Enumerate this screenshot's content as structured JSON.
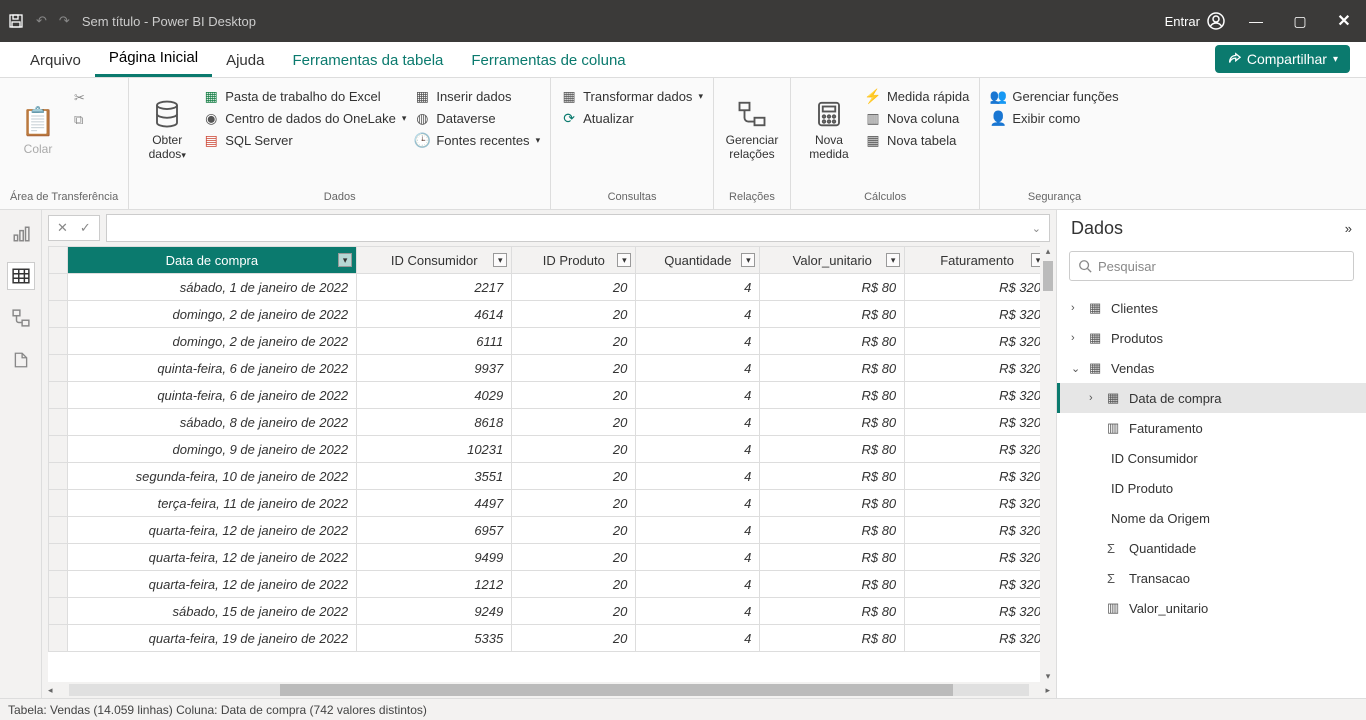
{
  "titlebar": {
    "title": "Sem título - Power BI Desktop",
    "sign_in": "Entrar"
  },
  "tabs": {
    "file": "Arquivo",
    "home": "Página Inicial",
    "help": "Ajuda",
    "table_tools": "Ferramentas da tabela",
    "column_tools": "Ferramentas de coluna",
    "share": "Compartilhar"
  },
  "ribbon": {
    "clipboard": {
      "paste": "Colar",
      "label": "Área de Transferência"
    },
    "data": {
      "get_data": "Obter dados",
      "excel": "Pasta de trabalho do Excel",
      "onelake": "Centro de dados do OneLake",
      "sql": "SQL Server",
      "enter_data": "Inserir dados",
      "dataverse": "Dataverse",
      "recent": "Fontes recentes",
      "label": "Dados"
    },
    "queries": {
      "transform": "Transformar dados",
      "refresh": "Atualizar",
      "label": "Consultas"
    },
    "relations": {
      "manage": "Gerenciar relações",
      "label": "Relações"
    },
    "calc": {
      "measure": "Nova medida",
      "quick_measure": "Medida rápida",
      "new_col": "Nova coluna",
      "new_table": "Nova tabela",
      "label": "Cálculos"
    },
    "security": {
      "roles": "Gerenciar funções",
      "view_as": "Exibir como",
      "label": "Segurança"
    }
  },
  "columns": [
    "Data de compra",
    "ID Consumidor",
    "ID Produto",
    "Quantidade",
    "Valor_unitario",
    "Faturamento"
  ],
  "rows": [
    [
      "sábado, 1 de janeiro de 2022",
      "2217",
      "20",
      "4",
      "R$ 80",
      "R$ 320"
    ],
    [
      "domingo, 2 de janeiro de 2022",
      "4614",
      "20",
      "4",
      "R$ 80",
      "R$ 320"
    ],
    [
      "domingo, 2 de janeiro de 2022",
      "6111",
      "20",
      "4",
      "R$ 80",
      "R$ 320"
    ],
    [
      "quinta-feira, 6 de janeiro de 2022",
      "9937",
      "20",
      "4",
      "R$ 80",
      "R$ 320"
    ],
    [
      "quinta-feira, 6 de janeiro de 2022",
      "4029",
      "20",
      "4",
      "R$ 80",
      "R$ 320"
    ],
    [
      "sábado, 8 de janeiro de 2022",
      "8618",
      "20",
      "4",
      "R$ 80",
      "R$ 320"
    ],
    [
      "domingo, 9 de janeiro de 2022",
      "10231",
      "20",
      "4",
      "R$ 80",
      "R$ 320"
    ],
    [
      "segunda-feira, 10 de janeiro de 2022",
      "3551",
      "20",
      "4",
      "R$ 80",
      "R$ 320"
    ],
    [
      "terça-feira, 11 de janeiro de 2022",
      "4497",
      "20",
      "4",
      "R$ 80",
      "R$ 320"
    ],
    [
      "quarta-feira, 12 de janeiro de 2022",
      "6957",
      "20",
      "4",
      "R$ 80",
      "R$ 320"
    ],
    [
      "quarta-feira, 12 de janeiro de 2022",
      "9499",
      "20",
      "4",
      "R$ 80",
      "R$ 320"
    ],
    [
      "quarta-feira, 12 de janeiro de 2022",
      "1212",
      "20",
      "4",
      "R$ 80",
      "R$ 320"
    ],
    [
      "sábado, 15 de janeiro de 2022",
      "9249",
      "20",
      "4",
      "R$ 80",
      "R$ 320"
    ],
    [
      "quarta-feira, 19 de janeiro de 2022",
      "5335",
      "20",
      "4",
      "R$ 80",
      "R$ 320"
    ]
  ],
  "rightpane": {
    "title": "Dados",
    "search_placeholder": "Pesquisar",
    "tables": {
      "clientes": "Clientes",
      "produtos": "Produtos",
      "vendas": "Vendas",
      "fields": {
        "data_compra": "Data de compra",
        "faturamento": "Faturamento",
        "id_consumidor": "ID Consumidor",
        "id_produto": "ID Produto",
        "nome_origem": "Nome da Origem",
        "quantidade": "Quantidade",
        "transacao": "Transacao",
        "valor_unitario": "Valor_unitario"
      }
    }
  },
  "statusbar": "Tabela: Vendas (14.059 linhas) Coluna: Data de compra (742 valores distintos)"
}
